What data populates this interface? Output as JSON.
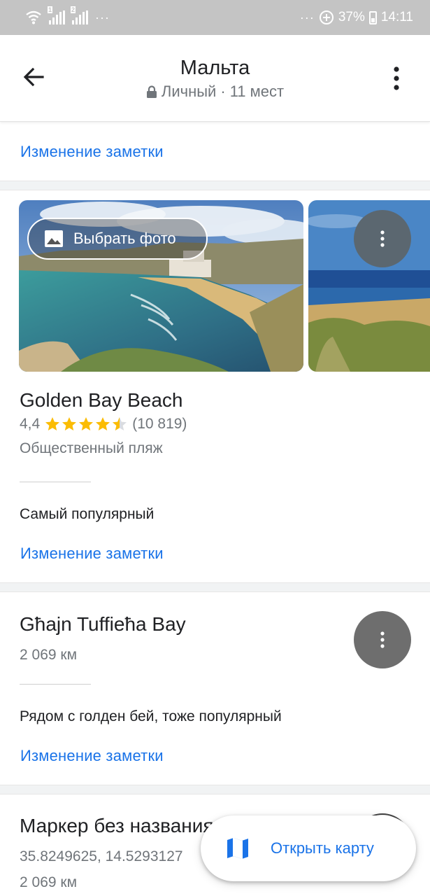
{
  "status_bar": {
    "sim1": "1",
    "sim2": "2",
    "left_dots": "···",
    "right_dots": "···",
    "battery": "37%",
    "time": "14:11"
  },
  "header": {
    "title": "Мальта",
    "privacy": "Личный",
    "separator": "·",
    "count": "11 мест"
  },
  "top_card": {
    "edit_note": "Изменение заметки"
  },
  "place1": {
    "pick_photo": "Выбрать фото",
    "name": "Golden Bay Beach",
    "rating": "4,4",
    "stars": 4.4,
    "reviews": "(10 819)",
    "category": "Общественный пляж",
    "note": "Самый популярный",
    "edit_note": "Изменение заметки"
  },
  "place2": {
    "name": "Għajn Tuffieħa Bay",
    "distance": "2 069 км",
    "note": "Рядом с голден бей, тоже популярный",
    "edit_note": "Изменение заметки"
  },
  "place3": {
    "name": "Маркер без названия",
    "coords": "35.8249625, 14.5293127",
    "distance": "2 069 км"
  },
  "fab": {
    "label": "Открыть карту"
  },
  "colors": {
    "accent": "#1a73e8",
    "star": "#fbbc04",
    "secondary_text": "#70757a"
  }
}
